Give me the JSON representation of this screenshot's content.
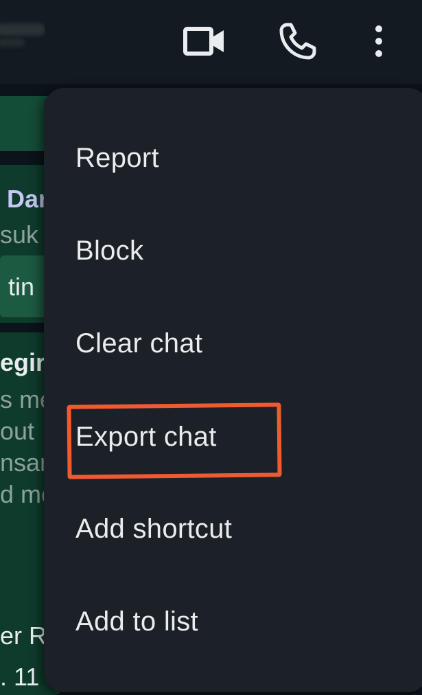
{
  "header": {
    "contact_name": "",
    "icons": {
      "video": "video-camera-icon",
      "call": "phone-icon",
      "more": "more-vertical-icon"
    }
  },
  "background_chat": {
    "fragments": [
      "Dar",
      "suk",
      "tin",
      "egir",
      "s me",
      "out",
      "nsar",
      "d me",
      "er R",
      ". 11"
    ]
  },
  "menu": {
    "items": [
      {
        "label": "Report"
      },
      {
        "label": "Block"
      },
      {
        "label": "Clear chat"
      },
      {
        "label": "Export chat"
      },
      {
        "label": "Add shortcut"
      },
      {
        "label": "Add to list"
      }
    ],
    "highlighted_item": "Export chat",
    "highlight_color": "#f05a33"
  },
  "colors": {
    "background": "#0b141a",
    "menu_background": "#1b2126",
    "text": "#e9edef",
    "bubble": "#0f3b2c"
  }
}
